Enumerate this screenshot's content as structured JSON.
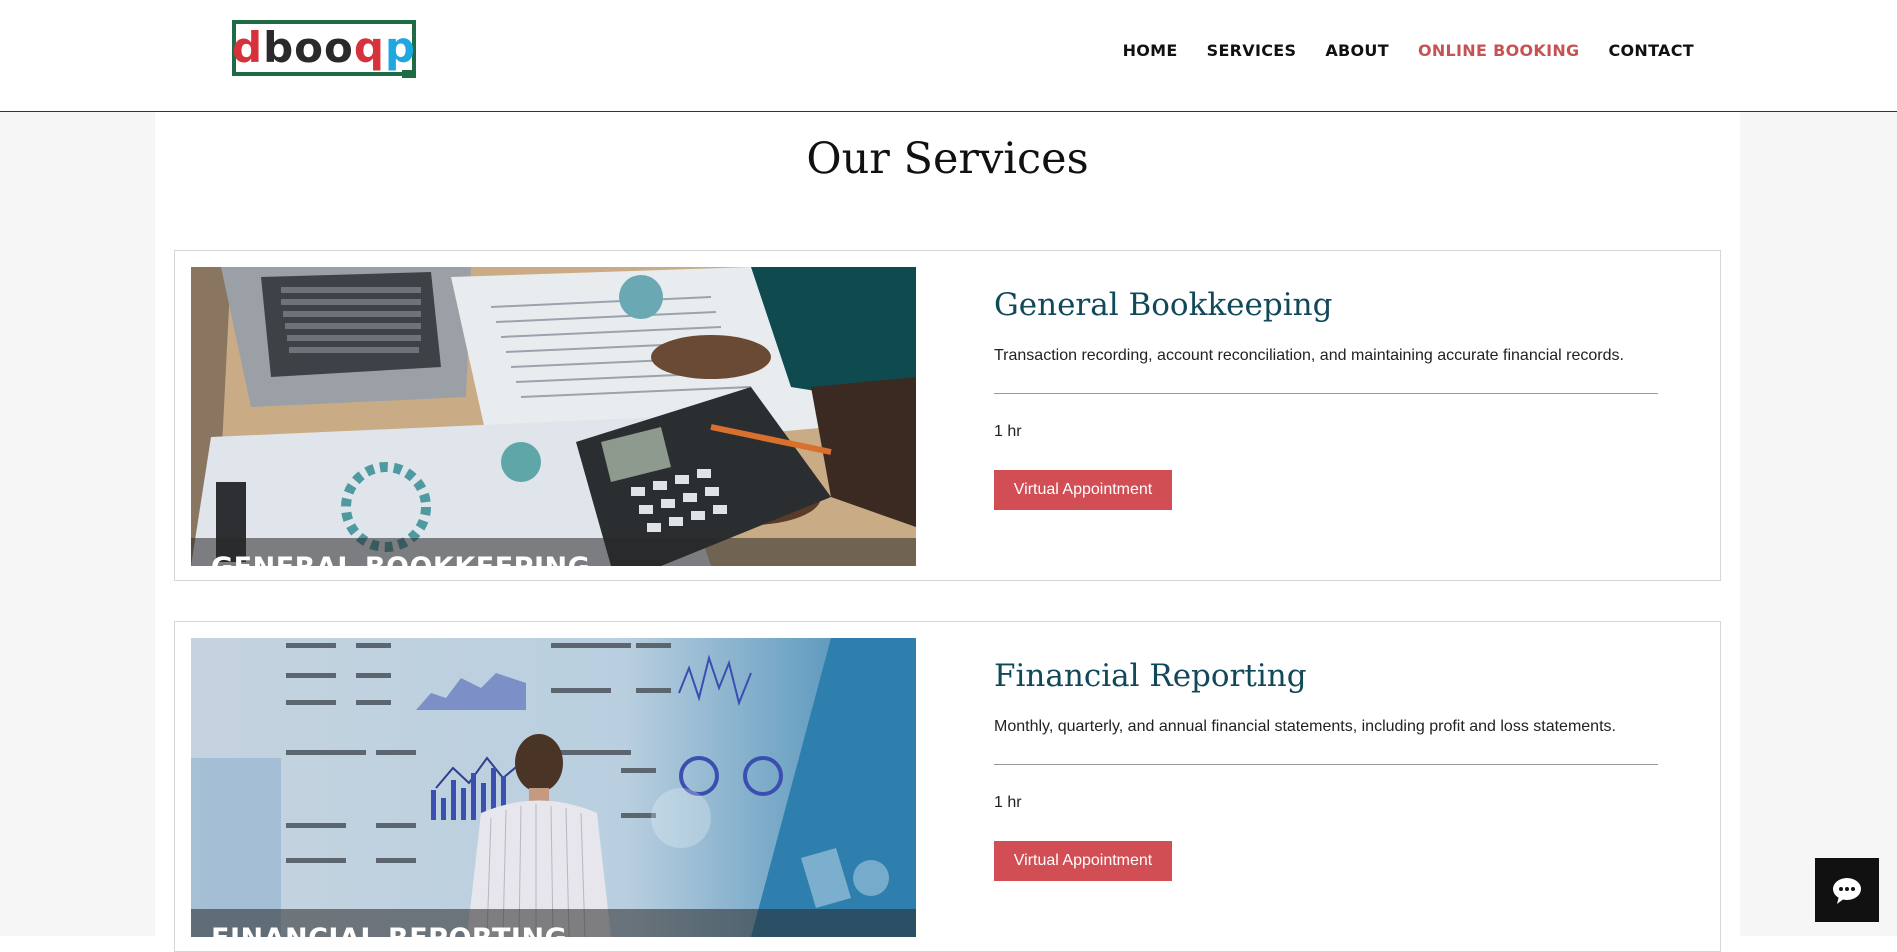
{
  "header": {
    "logo": {
      "text": "dbooqp",
      "parts": [
        "d",
        "boo",
        "q",
        "p"
      ]
    },
    "nav": [
      {
        "label": "HOME",
        "active": false
      },
      {
        "label": "SERVICES",
        "active": false
      },
      {
        "label": "ABOUT",
        "active": false
      },
      {
        "label": "ONLINE BOOKING",
        "active": true
      },
      {
        "label": "CONTACT",
        "active": false
      }
    ]
  },
  "main": {
    "title": "Our Services",
    "services": [
      {
        "image_caption": "GENERAL BOOKKEEPING",
        "image_subject": "laptop, calculator and financial documents on desk",
        "title": "General Bookkeeping",
        "description": "Transaction recording, account reconciliation, and maintaining accurate financial records.",
        "duration": "1 hr",
        "button_label": "Virtual Appointment"
      },
      {
        "image_caption": "FINANCIAL REPORTING",
        "image_subject": "man viewing financial statement charts on glass wall",
        "title": "Financial Reporting",
        "description": "Monthly, quarterly, and annual financial statements, including profit and loss statements.",
        "duration": "1 hr",
        "button_label": "Virtual Appointment"
      }
    ]
  },
  "chat": {
    "icon": "chat-bubble-icon"
  },
  "colors": {
    "accent_red": "#d24e55",
    "active_nav": "#c65353",
    "title_teal": "#11485a",
    "logo_green": "#1f6b45"
  }
}
